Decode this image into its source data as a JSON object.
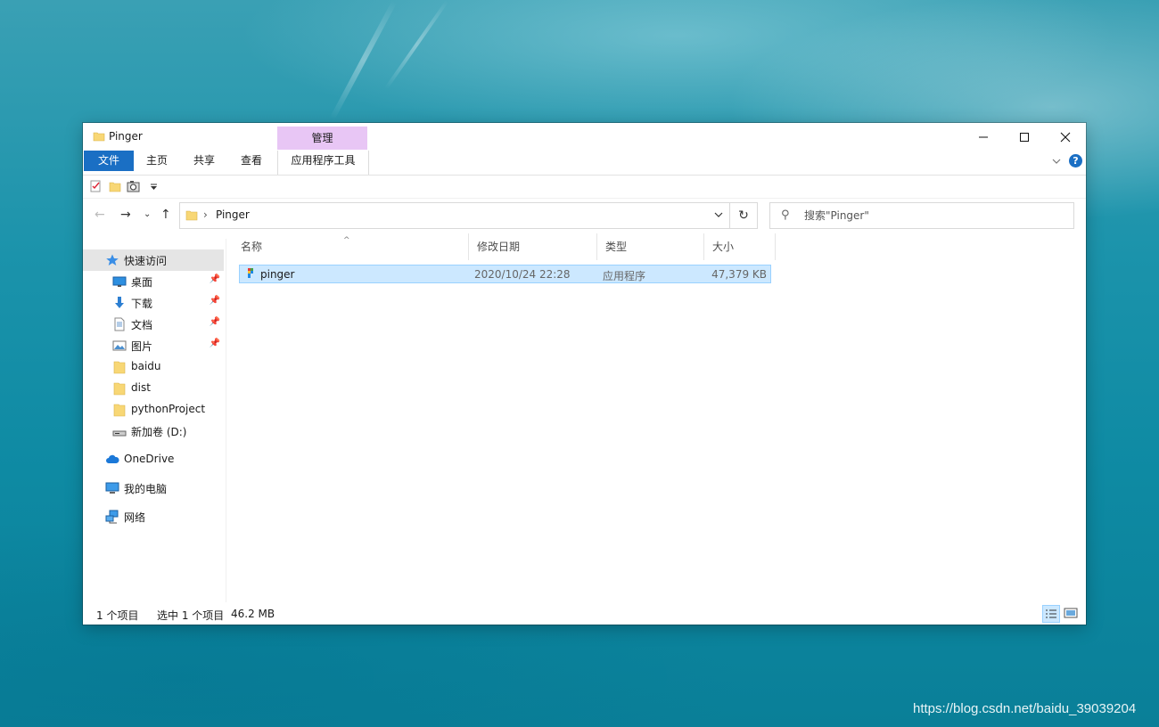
{
  "window": {
    "title": "Pinger",
    "context_group_title": "管理"
  },
  "ribbon": {
    "tabs": [
      {
        "label": "文件"
      },
      {
        "label": "主页"
      },
      {
        "label": "共享"
      },
      {
        "label": "查看"
      },
      {
        "label": "应用程序工具"
      }
    ]
  },
  "address": {
    "path": "Pinger"
  },
  "search": {
    "placeholder": "搜索\"Pinger\""
  },
  "sidebar": {
    "items": [
      {
        "label": "快速访问",
        "icon": "star-icon"
      },
      {
        "label": "桌面",
        "icon": "desktop-icon"
      },
      {
        "label": "下载",
        "icon": "download-arrow-icon"
      },
      {
        "label": "文档",
        "icon": "document-icon"
      },
      {
        "label": "图片",
        "icon": "picture-icon"
      },
      {
        "label": "baidu",
        "icon": "folder-icon"
      },
      {
        "label": "dist",
        "icon": "folder-icon"
      },
      {
        "label": "pythonProject",
        "icon": "folder-icon"
      },
      {
        "label": "新加卷 (D:)",
        "icon": "drive-icon"
      },
      {
        "label": "OneDrive",
        "icon": "cloud-icon"
      },
      {
        "label": "我的电脑",
        "icon": "computer-icon"
      },
      {
        "label": "网络",
        "icon": "network-icon"
      }
    ]
  },
  "columns": {
    "name": "名称",
    "date": "修改日期",
    "type": "类型",
    "size": "大小"
  },
  "files": [
    {
      "name": "pinger",
      "date": "2020/10/24 22:28",
      "type": "应用程序",
      "size": "47,379 KB"
    }
  ],
  "status": {
    "count": "1 个项目",
    "selected": "选中 1 个项目",
    "size": "46.2 MB"
  },
  "watermark": "https://blog.csdn.net/baidu_39039204",
  "colors": {
    "accent": "#1a6fc4",
    "selection_bg": "#cce8ff",
    "context_tab": "#e8c6f5"
  }
}
